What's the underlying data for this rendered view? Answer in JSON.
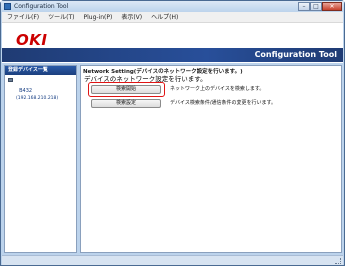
{
  "window": {
    "title": "Configuration Tool",
    "minimize_glyph": "–",
    "maximize_glyph": "□",
    "close_glyph": "✕"
  },
  "menu": {
    "items": [
      "ファイル(F)",
      "ツール(T)",
      "Plug-in(P)",
      "表示(V)",
      "ヘルプ(H)"
    ]
  },
  "banner": {
    "logo": "OKI",
    "title": "Configuration Tool",
    "strip_color": "#1f3b73",
    "logo_color": "#cc0000"
  },
  "sidebar": {
    "header": "登録デバイス一覧",
    "devices": [
      {
        "name": "B432",
        "ip": "(192.168.210.218)"
      }
    ]
  },
  "main": {
    "header": "Network Setting(デバイスのネットワーク設定を行います。)",
    "section_title": "デバイスのネットワーク設定を行います。",
    "buttons": [
      {
        "label": "検索開始",
        "description": "ネットワーク上のデバイスを検索します。"
      },
      {
        "label": "検索設定",
        "description": "デバイス検索条件/通信条件の変更を行います。"
      }
    ],
    "highlight_color": "#e01414"
  }
}
